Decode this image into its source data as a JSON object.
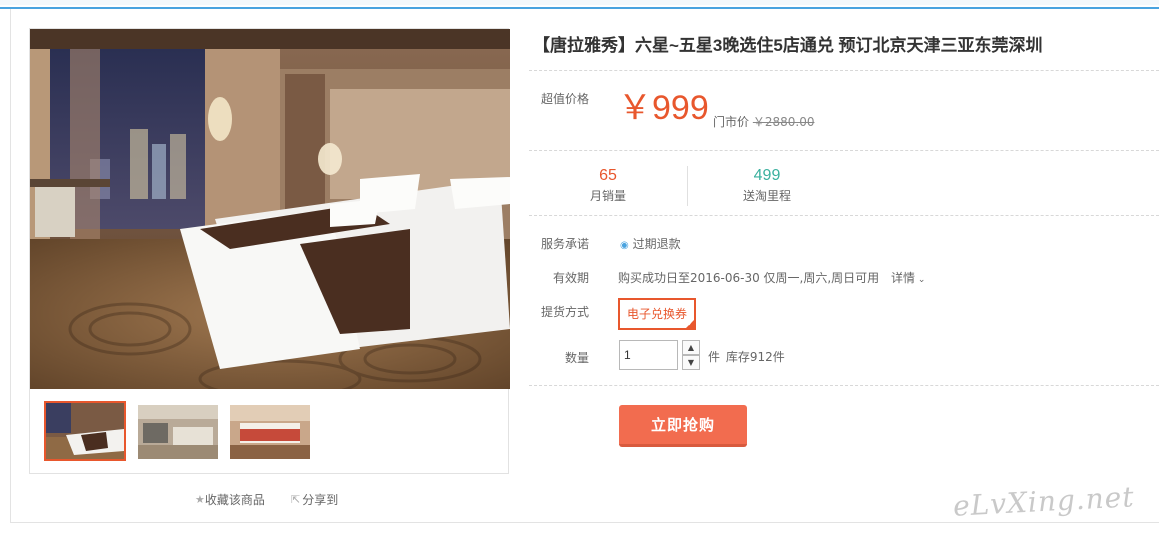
{
  "product": {
    "title": "【唐拉雅秀】六星~五星3晚选住5店通兑 预订北京天津三亚东莞深圳"
  },
  "price": {
    "label": "超值价格",
    "value": "￥999",
    "market_label": "门市价",
    "market_value": "￥2880.00"
  },
  "stats": {
    "monthly_sales": {
      "value": "65",
      "label": "月销量"
    },
    "mileage": {
      "value": "499",
      "label": "送淘里程"
    }
  },
  "service": {
    "label": "服务承诺",
    "value": "过期退款"
  },
  "validity": {
    "label": "有效期",
    "value": "购买成功日至2016-06-30 仅周一,周六,周日可用",
    "details": "详情"
  },
  "delivery": {
    "label": "提货方式",
    "option": "电子兑换券"
  },
  "quantity": {
    "label": "数量",
    "value": "1",
    "unit": "件",
    "stock": "库存912件"
  },
  "buy_button": "立即抢购",
  "gallery_actions": {
    "favorite": "收藏该商品",
    "share": "分享到"
  },
  "watermark": "eLvXing.net",
  "colors": {
    "accent": "#e8572d",
    "buy": "#f26c4f",
    "mileage": "#3ab09e",
    "topbar": "#4aa3df"
  }
}
